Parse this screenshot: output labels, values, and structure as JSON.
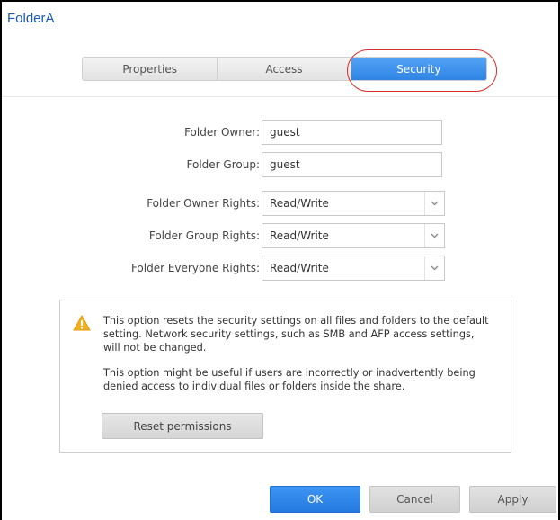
{
  "dialog": {
    "title": "FolderA"
  },
  "tabs": [
    {
      "label": "Properties",
      "active": false
    },
    {
      "label": "Access",
      "active": false
    },
    {
      "label": "Security",
      "active": true
    }
  ],
  "form": {
    "owner_label": "Folder Owner:",
    "owner_value": "guest",
    "group_label": "Folder Group:",
    "group_value": "guest",
    "owner_rights_label": "Folder Owner Rights:",
    "owner_rights_value": "Read/Write",
    "group_rights_label": "Folder Group Rights:",
    "group_rights_value": "Read/Write",
    "everyone_rights_label": "Folder Everyone Rights:",
    "everyone_rights_value": "Read/Write"
  },
  "notice": {
    "icon": "warning-icon",
    "paragraph1": "This option resets the security settings on all files and folders to the default setting. Network security settings, such as SMB and AFP access settings, will not be changed.",
    "paragraph2": "This option might be useful if users are incorrectly or inadvertently being denied access to individual files or folders inside the share.",
    "reset_label": "Reset permissions"
  },
  "footer": {
    "ok_label": "OK",
    "cancel_label": "Cancel",
    "apply_label": "Apply"
  },
  "colors": {
    "accent": "#3d95f2",
    "title": "#1a58b8",
    "highlight": "#d92b2b",
    "warning": "#f2b01e"
  }
}
